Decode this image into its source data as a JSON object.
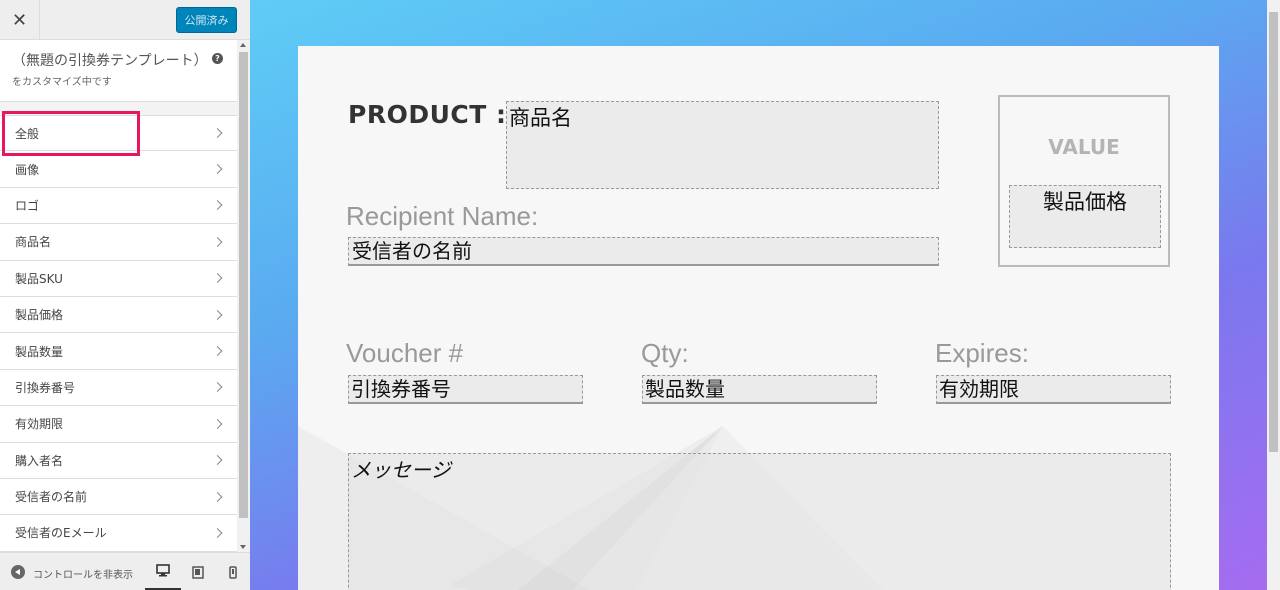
{
  "topbar": {
    "close_icon": "close-icon",
    "publish_label": "公開済み"
  },
  "info": {
    "title": "（無題の引換券テンプレート）",
    "customizing": "をカスタマイズ中です"
  },
  "panels": [
    "全般",
    "画像",
    "ロゴ",
    "商品名",
    "製品SKU",
    "製品価格",
    "製品数量",
    "引換券番号",
    "有効期限",
    "購入者名",
    "受信者の名前",
    "受信者のEメール"
  ],
  "footer": {
    "collapse_label": "コントロールを非表示",
    "devices": [
      "desktop-icon",
      "tablet-icon",
      "mobile-icon"
    ]
  },
  "voucher": {
    "product_label": "PRODUCT :",
    "product_field": "商品名",
    "value_label": "VALUE",
    "value_field": "製品価格",
    "recipient_label": "Recipient Name:",
    "recipient_field": "受信者の名前",
    "voucher_label": "Voucher #",
    "voucher_field": "引換券番号",
    "qty_label": "Qty:",
    "qty_field": "製品数量",
    "expires_label": "Expires:",
    "expires_field": "有効期限",
    "message_field": "メッセージ"
  },
  "colors": {
    "publish": "#0085ba",
    "highlight": "#e8175d"
  }
}
